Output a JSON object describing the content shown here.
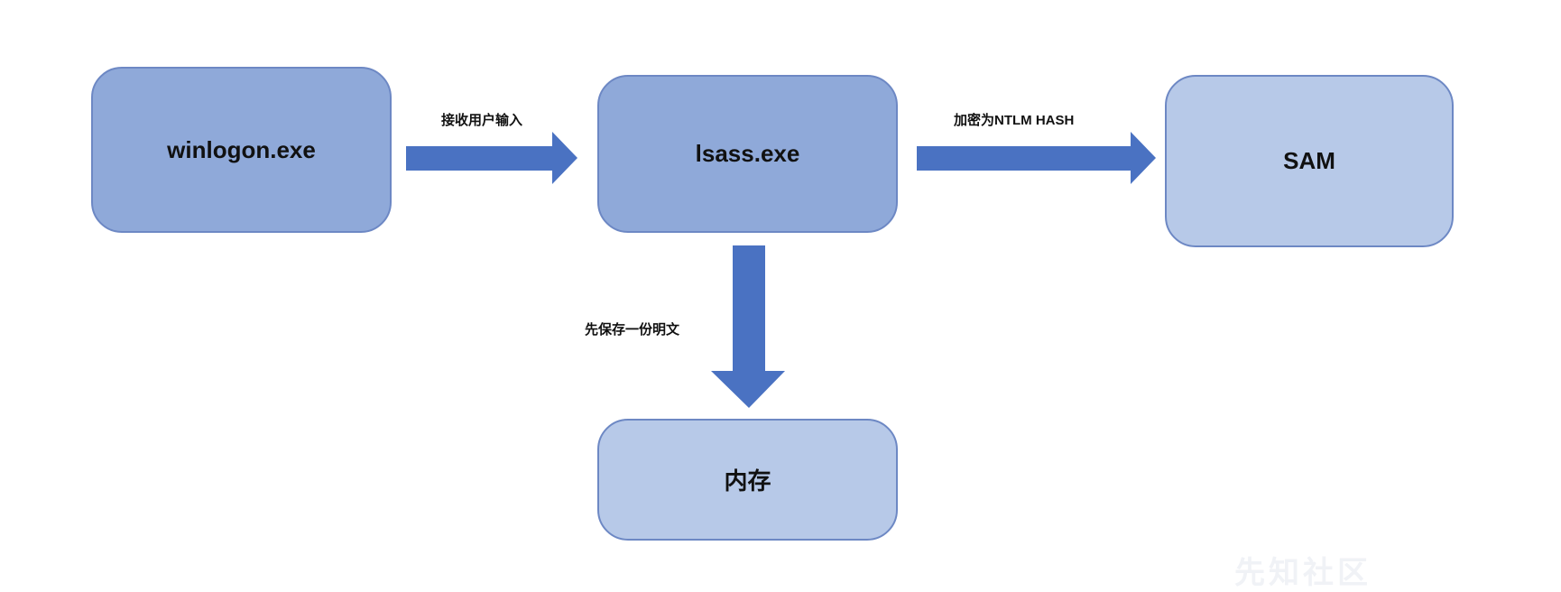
{
  "diagram": {
    "nodes": {
      "winlogon": "winlogon.exe",
      "lsass": "lsass.exe",
      "sam": "SAM",
      "memory": "内存"
    },
    "edges": {
      "receive_input": "接收用户输入",
      "encrypt": "加密为NTLM HASH",
      "save_plaintext": "先保存一份明文"
    },
    "colors": {
      "node_dark": "#8fa9d9",
      "node_light": "#b7c9e8",
      "node_border": "#6d88c4",
      "arrow": "#4a72c2"
    }
  },
  "watermark": "先知社区"
}
